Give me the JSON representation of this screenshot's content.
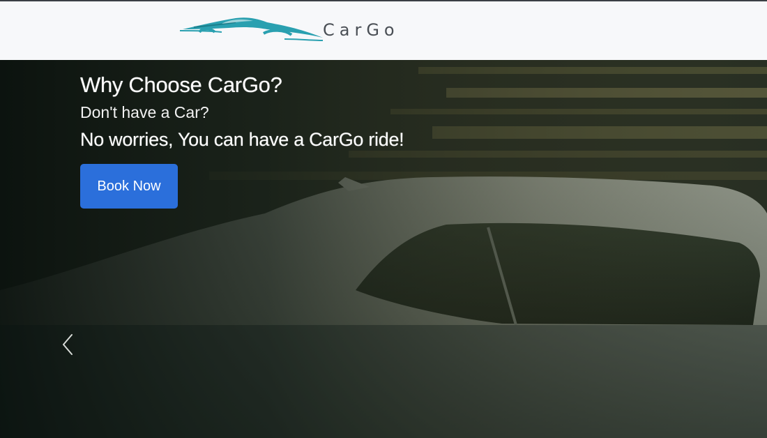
{
  "header": {
    "brand_text": "CarGo"
  },
  "hero": {
    "title": "Why Choose CarGo?",
    "subtitle": "Don't have a Car?",
    "tagline": "No worries, You can have a CarGo ride!",
    "cta_label": "Book Now"
  },
  "carousel": {
    "prev_icon": "chevron-left-icon"
  },
  "colors": {
    "brand_teal": "#2aa0b0",
    "brand_text": "#4a4f55",
    "cta_blue": "#2b6fdb",
    "header_bg": "#f7f8fa"
  }
}
